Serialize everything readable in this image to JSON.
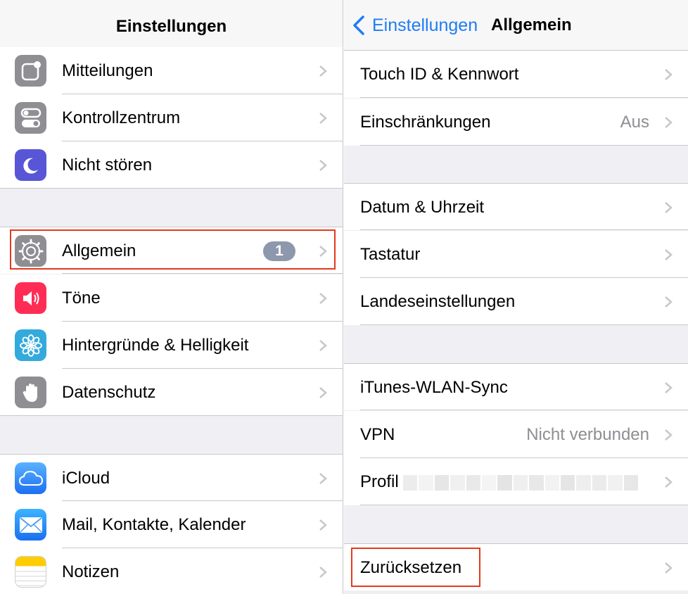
{
  "left": {
    "title": "Einstellungen",
    "groups": [
      [
        {
          "label": "Mitteilungen",
          "icon": "notifications-icon",
          "color": "#8e8e93"
        },
        {
          "label": "Kontrollzentrum",
          "icon": "control-center-icon",
          "color": "#8e8e93"
        },
        {
          "label": "Nicht stören",
          "icon": "do-not-disturb-icon",
          "color": "#5856d6"
        }
      ],
      [
        {
          "label": "Allgemein",
          "icon": "gear-icon",
          "color": "#8e8e93",
          "badge": "1",
          "highlighted": true
        },
        {
          "label": "Töne",
          "icon": "speaker-icon",
          "color": "#ff2d55"
        },
        {
          "label": "Hintergründe & Helligkeit",
          "icon": "wallpaper-flower-icon",
          "color": "#34aadc"
        },
        {
          "label": "Datenschutz",
          "icon": "privacy-hand-icon",
          "color": "#8e8e93"
        }
      ],
      [
        {
          "label": "iCloud",
          "icon": "icloud-icon",
          "color": "#1d8cf8"
        },
        {
          "label": "Mail, Kontakte, Kalender",
          "icon": "mail-icon",
          "color": "#1e90ff"
        },
        {
          "label": "Notizen",
          "icon": "notes-icon",
          "color": "#ffcc00"
        }
      ]
    ]
  },
  "right": {
    "back_label": "Einstellungen",
    "title": "Allgemein",
    "groups": [
      [
        {
          "label": "Touch ID & Kennwort"
        },
        {
          "label": "Einschränkungen",
          "value": "Aus"
        }
      ],
      [
        {
          "label": "Datum & Uhrzeit"
        },
        {
          "label": "Tastatur"
        },
        {
          "label": "Landeseinstellungen"
        }
      ],
      [
        {
          "label": "iTunes-WLAN-Sync"
        },
        {
          "label": "VPN",
          "value": "Nicht verbunden"
        },
        {
          "label": "Profil",
          "value_obscured": true
        }
      ],
      [
        {
          "label": "Zurücksetzen",
          "highlighted": true
        }
      ]
    ]
  },
  "colors": {
    "accent": "#1f7cf5",
    "highlight": "#e5391c",
    "group_background": "#efeff4"
  }
}
